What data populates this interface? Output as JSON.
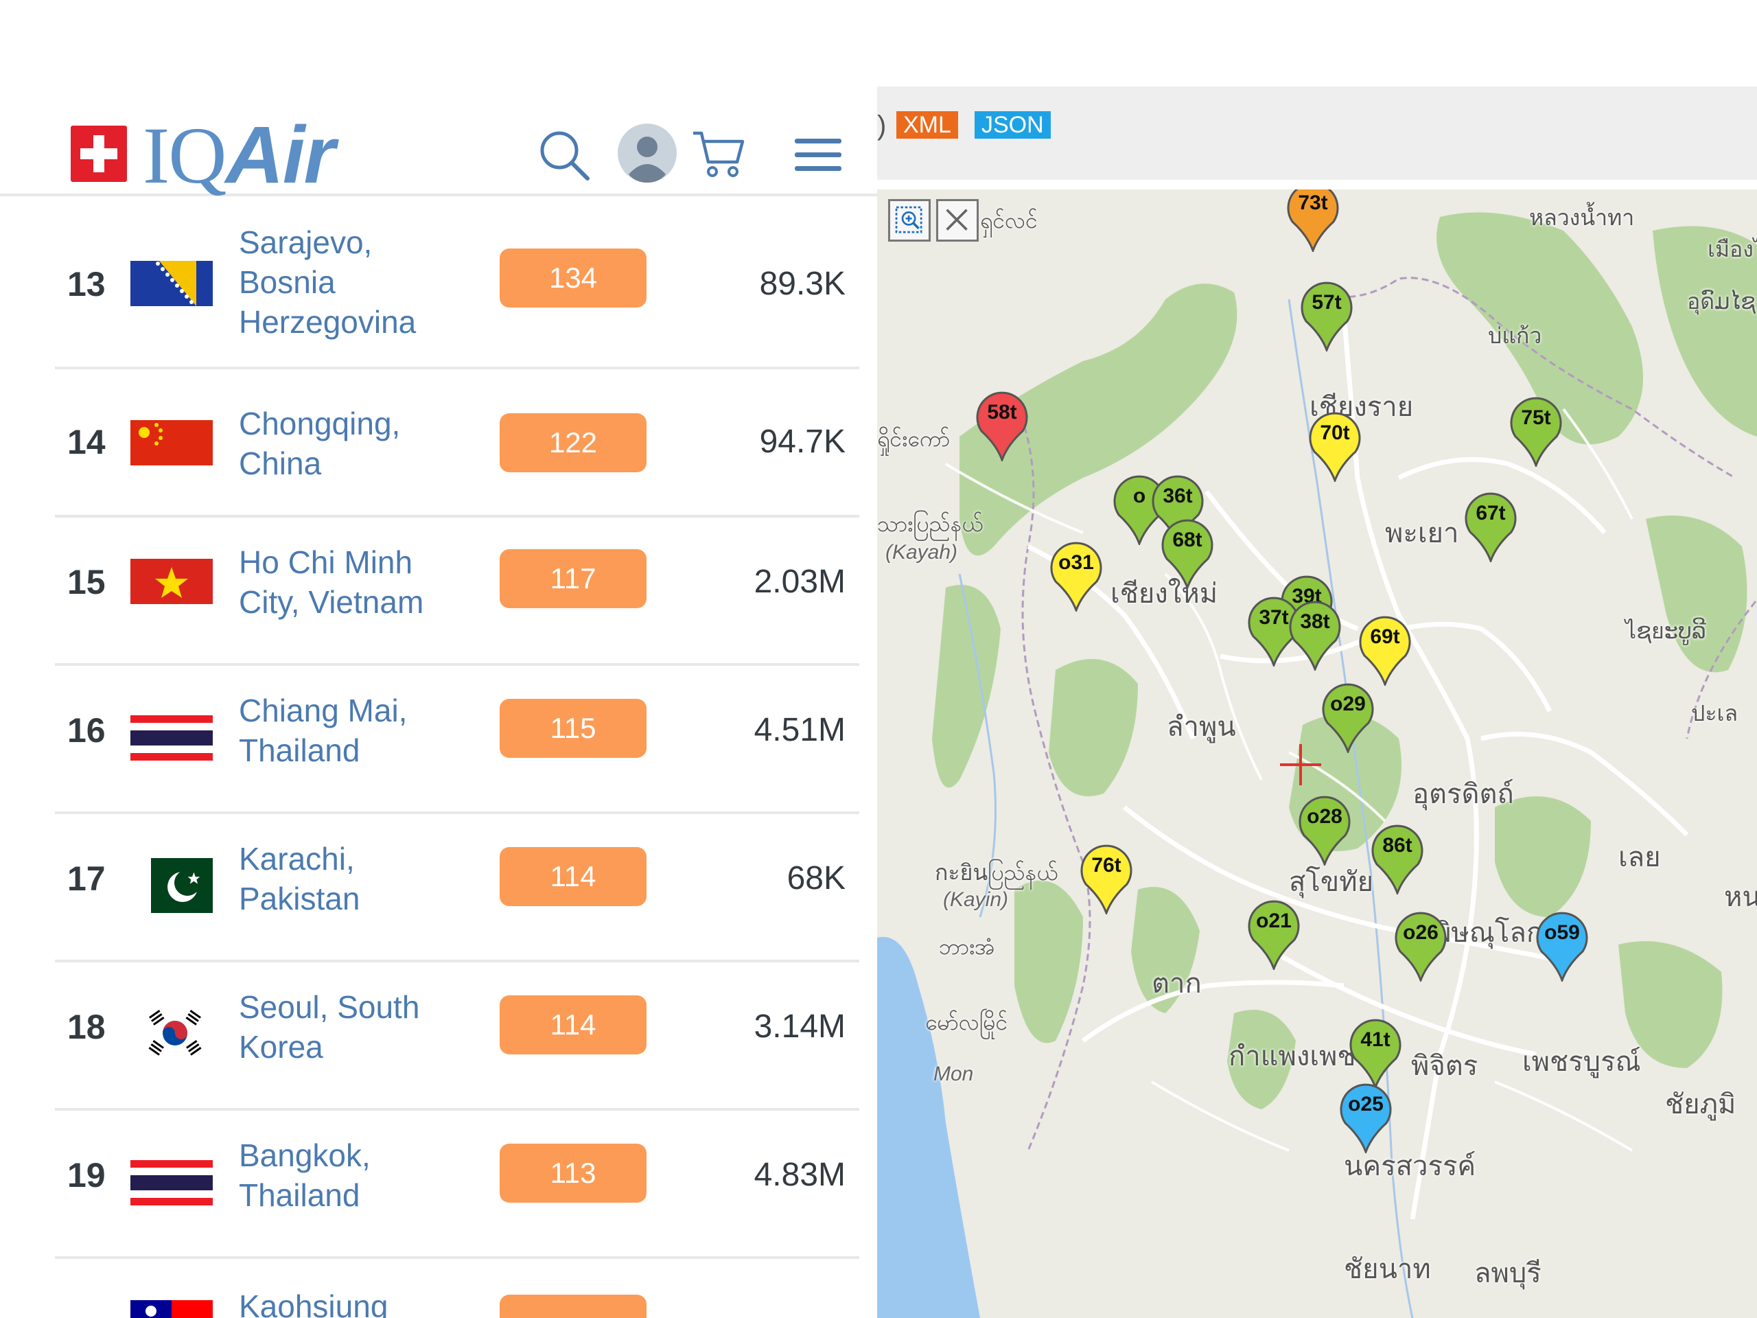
{
  "brand": {
    "logo_prefix": "IQ",
    "logo_suffix": "Air",
    "brand_color": "#5b8fc6",
    "flag_color": "#e2202b"
  },
  "header_icons": [
    "search-icon",
    "avatar",
    "cart-icon",
    "hamburger-menu-icon"
  ],
  "ranking": [
    {
      "rank": "13",
      "city": "Sarajevo, Bosnia Herzegovina",
      "aqi": "134",
      "followers": "89.3K",
      "flag": "bosnia"
    },
    {
      "rank": "14",
      "city": "Chongqing, China",
      "aqi": "122",
      "followers": "94.7K",
      "flag": "china"
    },
    {
      "rank": "15",
      "city": "Ho Chi Minh City, Vietnam",
      "aqi": "117",
      "followers": "2.03M",
      "flag": "vietnam"
    },
    {
      "rank": "16",
      "city": "Chiang Mai, Thailand",
      "aqi": "115",
      "followers": "4.51M",
      "flag": "thailand"
    },
    {
      "rank": "17",
      "city": "Karachi, Pakistan",
      "aqi": "114",
      "followers": "68K",
      "flag": "pakistan"
    },
    {
      "rank": "18",
      "city": "Seoul, South Korea",
      "aqi": "114",
      "followers": "3.14M",
      "flag": "korea"
    },
    {
      "rank": "19",
      "city": "Bangkok, Thailand",
      "aqi": "113",
      "followers": "4.83M",
      "flag": "thailand"
    },
    {
      "rank": "",
      "city": "Kaohsiung",
      "aqi": "",
      "followers": "",
      "flag": "taiwan"
    }
  ],
  "aqi_badge_color": "#fc9b55",
  "map_toolbar": {
    "truncated_text": ")",
    "xml_label": "XML",
    "json_label": "JSON"
  },
  "map_labels": [
    {
      "text": "หลวงน้ำทา"
    },
    {
      "text": "เมืองไซ"
    },
    {
      "text": "อุดົມໄຊ"
    },
    {
      "text": "บ่แก้ว"
    },
    {
      "text": "เชียงราย"
    },
    {
      "text": "ရှင်လင်"
    },
    {
      "text": "ရှိုင်းကော်"
    },
    {
      "text": "พะเยา"
    },
    {
      "text": "သားပြည်နယ်"
    },
    {
      "text": "(Kayah)"
    },
    {
      "text": "เชียงใหม่"
    },
    {
      "text": "ไຊยະບູລີ"
    },
    {
      "text": "ลำพูน"
    },
    {
      "text": "อุตรดิตถ์"
    },
    {
      "text": "ปะเล"
    },
    {
      "text": "กะยินပြည်နယ်"
    },
    {
      "text": "(Kayin)"
    },
    {
      "text": "สุโขทัย"
    },
    {
      "text": "เลย"
    },
    {
      "text": "หนอ"
    },
    {
      "text": "พิษณุโลก"
    },
    {
      "text": "ဘားအံ"
    },
    {
      "text": "ตาก"
    },
    {
      "text": "မော်လမြိုင်"
    },
    {
      "text": "Mon"
    },
    {
      "text": "กำแพงเพชร"
    },
    {
      "text": "พิจิตร"
    },
    {
      "text": "เพชรบูรณ์"
    },
    {
      "text": "ชัยภูมิ"
    },
    {
      "text": "นครสวรรค์"
    },
    {
      "text": "ชัยนาท"
    },
    {
      "text": "ลพบุรี"
    }
  ],
  "markers": [
    {
      "label": "73t",
      "color": "#f29b2b"
    },
    {
      "label": "57t",
      "color": "#8dc63f"
    },
    {
      "label": "58t",
      "color": "#ef4a4f"
    },
    {
      "label": "70t",
      "color": "#ffee33"
    },
    {
      "label": "75t",
      "color": "#8dc63f"
    },
    {
      "label": "o",
      "color": "#8dc63f"
    },
    {
      "label": "36t",
      "color": "#8dc63f"
    },
    {
      "label": "68t",
      "color": "#8dc63f"
    },
    {
      "label": "67t",
      "color": "#8dc63f"
    },
    {
      "label": "o31",
      "color": "#ffee33"
    },
    {
      "label": "39t",
      "color": "#8dc63f"
    },
    {
      "label": "37t",
      "color": "#8dc63f"
    },
    {
      "label": "38t",
      "color": "#8dc63f"
    },
    {
      "label": "69t",
      "color": "#ffee33"
    },
    {
      "label": "o29",
      "color": "#8dc63f"
    },
    {
      "label": "o28",
      "color": "#8dc63f"
    },
    {
      "label": "86t",
      "color": "#8dc63f"
    },
    {
      "label": "76t",
      "color": "#ffee33"
    },
    {
      "label": "o21",
      "color": "#8dc63f"
    },
    {
      "label": "o26",
      "color": "#8dc63f"
    },
    {
      "label": "o59",
      "color": "#3ab4f2"
    },
    {
      "label": "41t",
      "color": "#8dc63f"
    },
    {
      "label": "o25",
      "color": "#3ab4f2"
    }
  ]
}
